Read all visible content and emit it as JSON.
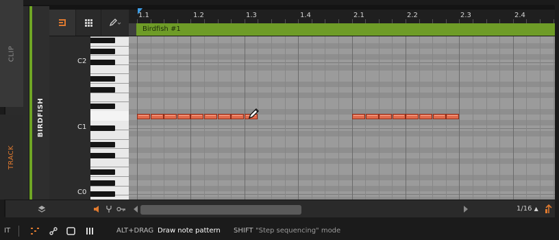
{
  "side_tabs": {
    "clip": "CLIP",
    "track": "TRACK"
  },
  "track_name": "BIRDFISH",
  "toolbar": {
    "notes_icon": "notes-icon",
    "grid_icon": "grid-icon",
    "pencil_icon": "pencil-tool-icon"
  },
  "ruler": {
    "labels": [
      "1.1",
      "1.2",
      "1.3",
      "1.4",
      "2.1",
      "2.2",
      "2.3",
      "2.4"
    ]
  },
  "clip": {
    "name": "Birdfish #1",
    "color": "#6e9c27"
  },
  "keys": {
    "c2": "C2",
    "c1": "C1",
    "c0": "C0"
  },
  "notes": {
    "color": "#e0694a",
    "count": 17
  },
  "bottom": {
    "zoom": "1/16"
  },
  "status": {
    "left_text": "IT",
    "hint1_key": "ALT+DRAG",
    "hint1_text": "Draw note pattern",
    "hint2_key": "SHIFT",
    "hint2_text": "\"Step sequencing\" mode"
  }
}
